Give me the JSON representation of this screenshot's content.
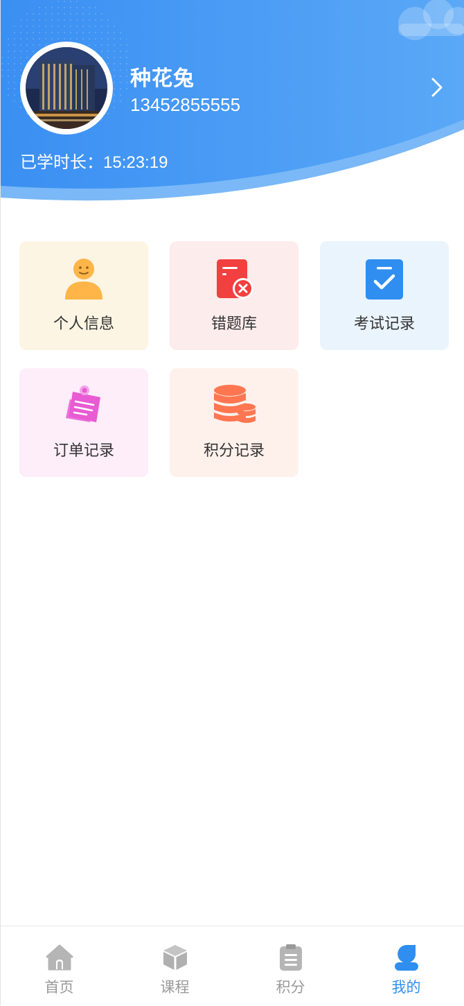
{
  "profile": {
    "name": "种花兔",
    "phone": "13452855555",
    "study_label": "已学时长：",
    "study_time": "15:23:19"
  },
  "menu": [
    {
      "label": "个人信息",
      "icon": "person-icon",
      "bg": "#fcf5e3",
      "color": "#ffb548"
    },
    {
      "label": "错题库",
      "icon": "wrong-question-icon",
      "bg": "#fdecec",
      "color": "#f23f3f"
    },
    {
      "label": "考试记录",
      "icon": "exam-record-icon",
      "bg": "#e9f4fd",
      "color": "#2f8ef0"
    },
    {
      "label": "订单记录",
      "icon": "order-record-icon",
      "bg": "#fdeefa",
      "color": "#e85bd3"
    },
    {
      "label": "积分记录",
      "icon": "coins-icon",
      "bg": "#fef1ec",
      "color": "#ff7650"
    }
  ],
  "tabbar": [
    {
      "label": "首页",
      "icon": "home-icon",
      "active": false
    },
    {
      "label": "课程",
      "icon": "cube-icon",
      "active": false
    },
    {
      "label": "积分",
      "icon": "clipboard-icon",
      "active": false
    },
    {
      "label": "我的",
      "icon": "user-icon",
      "active": true
    }
  ],
  "colors": {
    "header_blue": "#3a8ff2",
    "active": "#2f8ef0",
    "inactive": "#999999"
  }
}
